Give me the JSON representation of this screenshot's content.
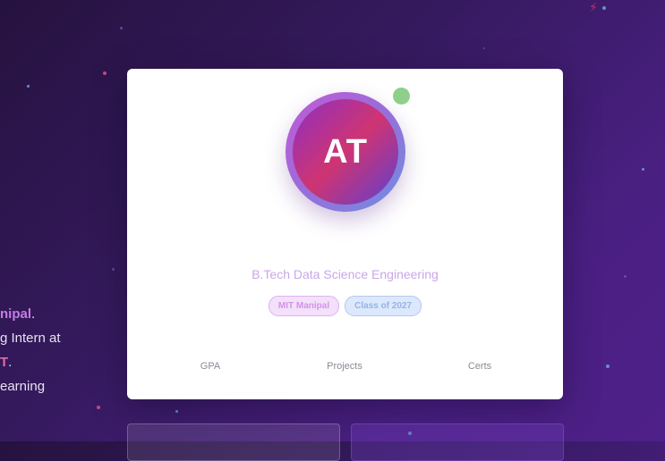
{
  "side_text": {
    "line1_highlight": "nipal",
    "line1_suffix": ".",
    "line2": "g Intern at",
    "line3_highlight": "T",
    "line3_suffix": ".",
    "line4": "earning"
  },
  "profile": {
    "initials": "AT",
    "degree": "B.Tech Data Science Engineering",
    "badges": [
      "MIT Manipal",
      "Class of 2027"
    ],
    "stats": [
      "GPA",
      "Projects",
      "Certs"
    ]
  },
  "colors": {
    "background_start": "#26123f",
    "background_end": "#4e2089",
    "accent_purple": "#c77be6",
    "accent_pink": "#e26ba6",
    "status_online": "#8ed08b"
  }
}
